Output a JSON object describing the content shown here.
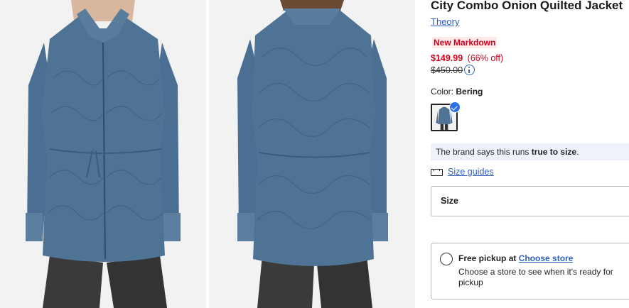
{
  "product": {
    "title": "City Combo Onion Quilted Jacket",
    "brand": "Theory",
    "badge": "New Markdown",
    "price": "$149.99",
    "discount": "(66% off)",
    "original_price": "$450.00"
  },
  "color": {
    "label": "Color:",
    "value": "Bering"
  },
  "fit_note": {
    "prefix": "The brand says this runs ",
    "emphasis": "true to size",
    "suffix": "."
  },
  "size_guides": {
    "label": "Size guides"
  },
  "size_selector": {
    "label": "Size"
  },
  "pickup": {
    "title_prefix": "Free pickup at ",
    "link": "Choose store",
    "description": "Choose a store to see when it's ready for pickup"
  },
  "colors": {
    "jacket": "#4f7395",
    "sale_red": "#d0021b",
    "link_blue": "#2f5fbf"
  },
  "icons": [
    "info-icon",
    "check-icon",
    "ruler-icon",
    "radio-icon"
  ]
}
